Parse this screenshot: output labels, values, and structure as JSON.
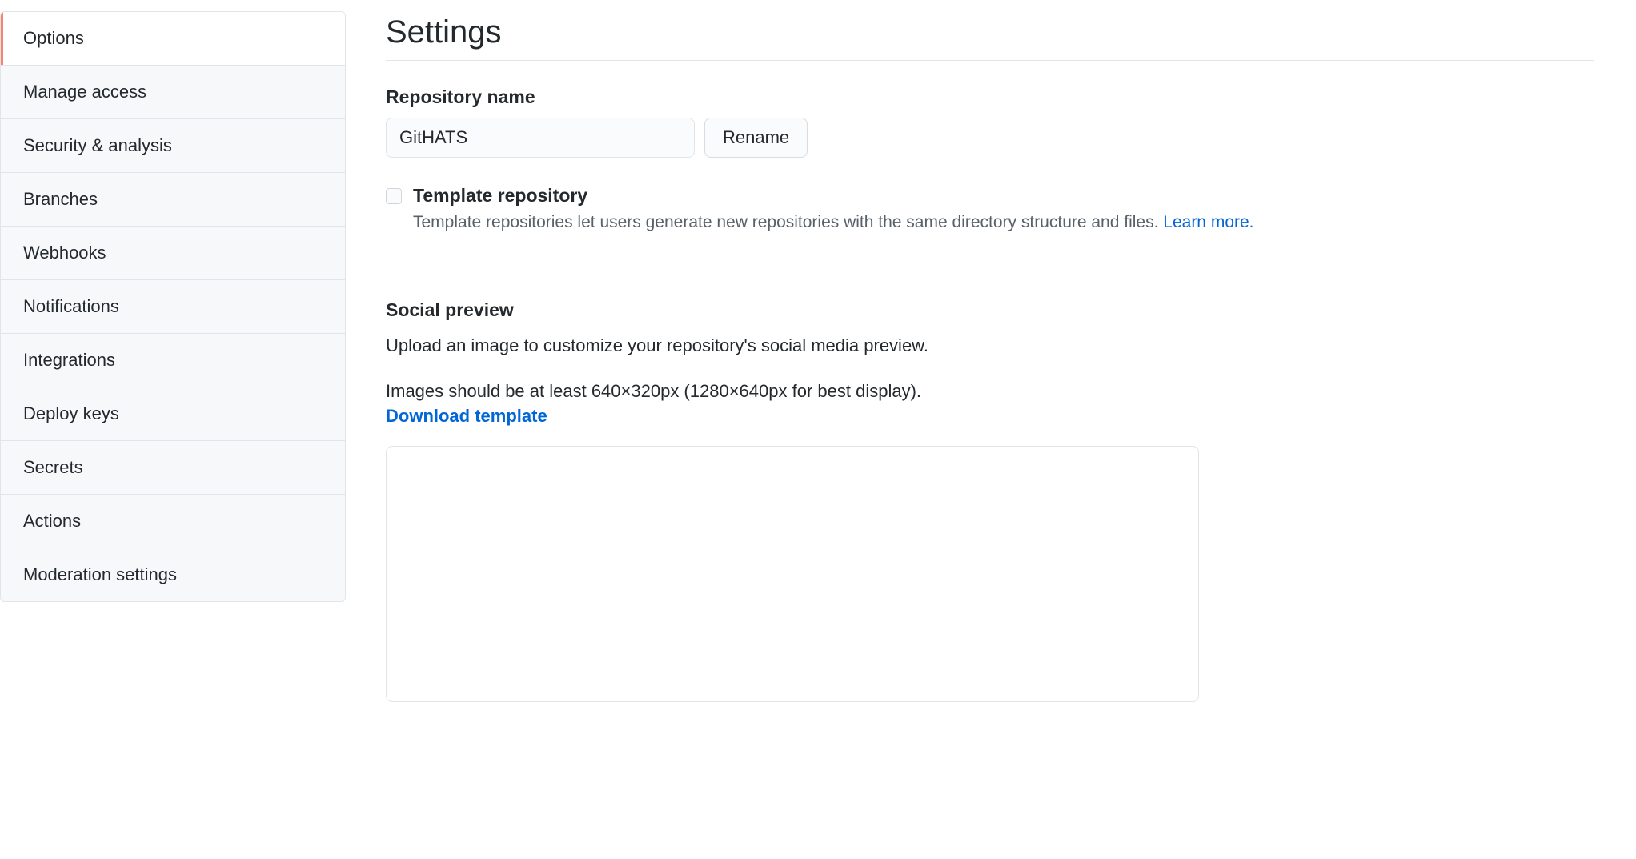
{
  "sidebar": {
    "items": [
      {
        "label": "Options",
        "active": true
      },
      {
        "label": "Manage access",
        "active": false
      },
      {
        "label": "Security & analysis",
        "active": false
      },
      {
        "label": "Branches",
        "active": false
      },
      {
        "label": "Webhooks",
        "active": false
      },
      {
        "label": "Notifications",
        "active": false
      },
      {
        "label": "Integrations",
        "active": false
      },
      {
        "label": "Deploy keys",
        "active": false
      },
      {
        "label": "Secrets",
        "active": false
      },
      {
        "label": "Actions",
        "active": false
      },
      {
        "label": "Moderation settings",
        "active": false
      }
    ]
  },
  "main": {
    "title": "Settings",
    "repo_name": {
      "label": "Repository name",
      "value": "GitHATS",
      "rename_button": "Rename"
    },
    "template": {
      "label": "Template repository",
      "description": "Template repositories let users generate new repositories with the same directory structure and files. ",
      "learn_more": "Learn more.",
      "checked": false
    },
    "social": {
      "heading": "Social preview",
      "desc1": "Upload an image to customize your repository's social media preview.",
      "desc2": "Images should be at least 640×320px (1280×640px for best display).",
      "download_link": "Download template"
    }
  }
}
